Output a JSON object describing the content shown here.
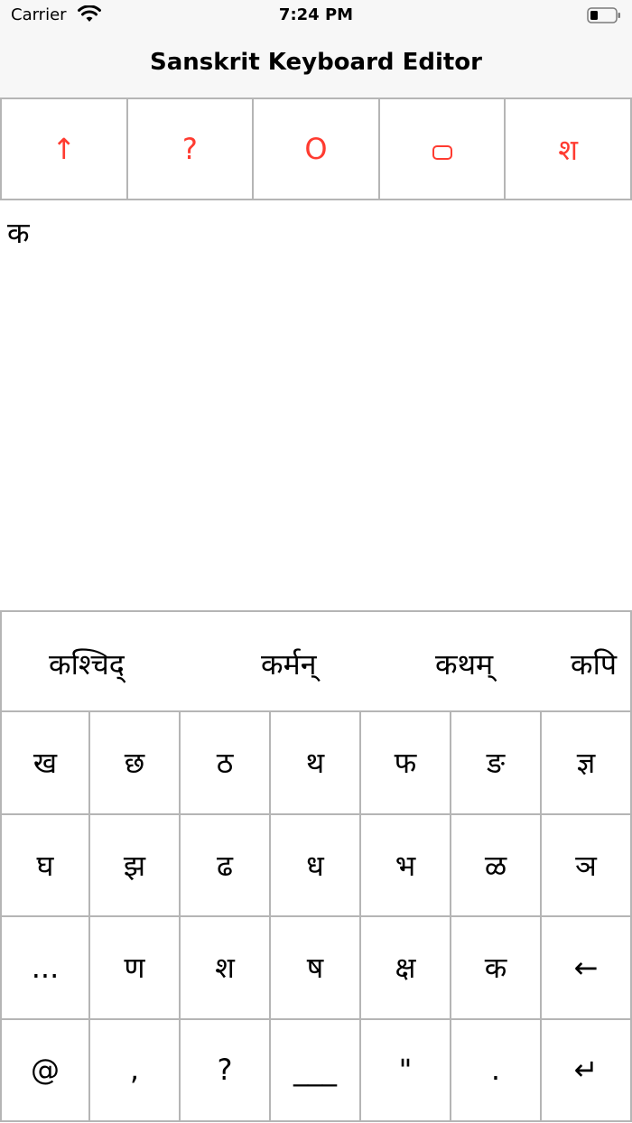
{
  "status_bar": {
    "carrier": "Carrier",
    "time": "7:24 PM"
  },
  "nav": {
    "title": "Sanskrit Keyboard Editor"
  },
  "toolbar": {
    "buttons": [
      {
        "label": "↑",
        "icon": "up-arrow-icon"
      },
      {
        "label": "?",
        "icon": "question-icon"
      },
      {
        "label": "O",
        "icon": "circle-o-icon"
      },
      {
        "label": "",
        "icon": "rounded-rect-icon"
      },
      {
        "label": "श",
        "icon": "sha-glyph"
      }
    ],
    "accent_color": "#ff3b30"
  },
  "editor": {
    "text": "क"
  },
  "suggestions": [
    "कश्चिद्",
    "कर्मन्",
    "कथम्",
    "कपि"
  ],
  "keyboard": {
    "rows": [
      [
        "ख",
        "छ",
        "ठ",
        "थ",
        "फ",
        "ङ",
        "ज्ञ"
      ],
      [
        "घ",
        "झ",
        "ढ",
        "ध",
        "भ",
        "ळ",
        "ञ"
      ],
      [
        "...",
        "ण",
        "श",
        "ष",
        "क्ष",
        "क",
        "←"
      ],
      [
        "@",
        ",",
        "?",
        "___",
        "\"",
        ".",
        "↵"
      ]
    ]
  }
}
